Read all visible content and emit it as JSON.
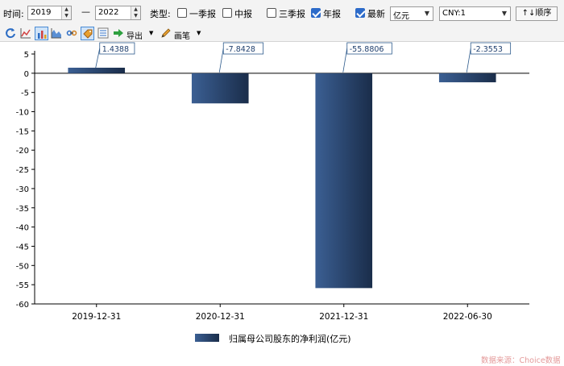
{
  "toolbar": {
    "time_label": "时间:",
    "start_year": "2019",
    "dash": "—",
    "end_year": "2022",
    "type_label": "类型:",
    "checkboxes": [
      {
        "label": "一季报",
        "checked": false
      },
      {
        "label": "中报",
        "checked": false
      },
      {
        "label": "三季报",
        "checked": false
      },
      {
        "label": "年报",
        "checked": true
      },
      {
        "label": "最新",
        "checked": true
      }
    ],
    "unit_select": "亿元",
    "currency_select": "CNY:1",
    "order_button": "↑↓顺序"
  },
  "icon_toolbar": {
    "icons": [
      "refresh-icon",
      "line-chart-icon",
      "bar-chart-icon",
      "area-chart-icon",
      "link-icon",
      "tag-icon",
      "list-icon",
      "export-arrow-icon",
      "pencil-icon"
    ],
    "export_label": "导出",
    "draw_label": "画笔"
  },
  "chart_data": {
    "type": "bar",
    "categories": [
      "2019-12-31",
      "2020-12-31",
      "2021-12-31",
      "2022-06-30"
    ],
    "series": [
      {
        "name": "归属母公司股东的净利润(亿元)",
        "values": [
          1.4388,
          -7.8428,
          -55.8806,
          -2.3553
        ],
        "labels": [
          "1.4388",
          "-7.8428",
          "-55.8806",
          "-2.3553"
        ]
      }
    ],
    "ylim": [
      -60,
      5
    ],
    "yticks": [
      5,
      0,
      -5,
      -10,
      -15,
      -20,
      -25,
      -30,
      -35,
      -40,
      -45,
      -50,
      -55,
      -60
    ],
    "bar_gradient": [
      "#3b5f93",
      "#1a2d4a"
    ],
    "legend_position": "bottom-center",
    "grid": false
  },
  "source": "数据来源：Choice数据"
}
